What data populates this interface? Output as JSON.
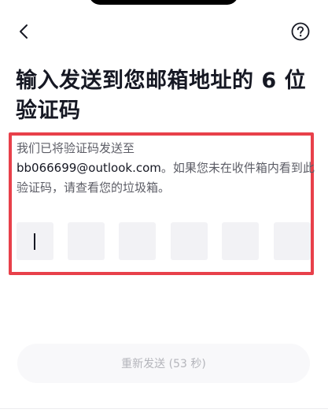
{
  "header": {
    "back_icon": "chevron-left-icon",
    "help_icon": "question-circle-icon"
  },
  "title": "输入发送到您邮箱地址的 6 位验证码",
  "description": {
    "line1": "我们已将验证码发送至",
    "email": "bb066699@outlook.com",
    "rest": "。如果您未在收件箱内看到此验证码，请查看您的垃圾箱。"
  },
  "code_input": {
    "digits": [
      "",
      "",
      "",
      "",
      "",
      ""
    ],
    "active_index": 0
  },
  "resend": {
    "label": "重新发送 (53 秒)"
  },
  "colors": {
    "highlight_border": "#e8404a",
    "code_box_bg": "#f2f2f5",
    "button_text_disabled": "#b4b5bb"
  }
}
